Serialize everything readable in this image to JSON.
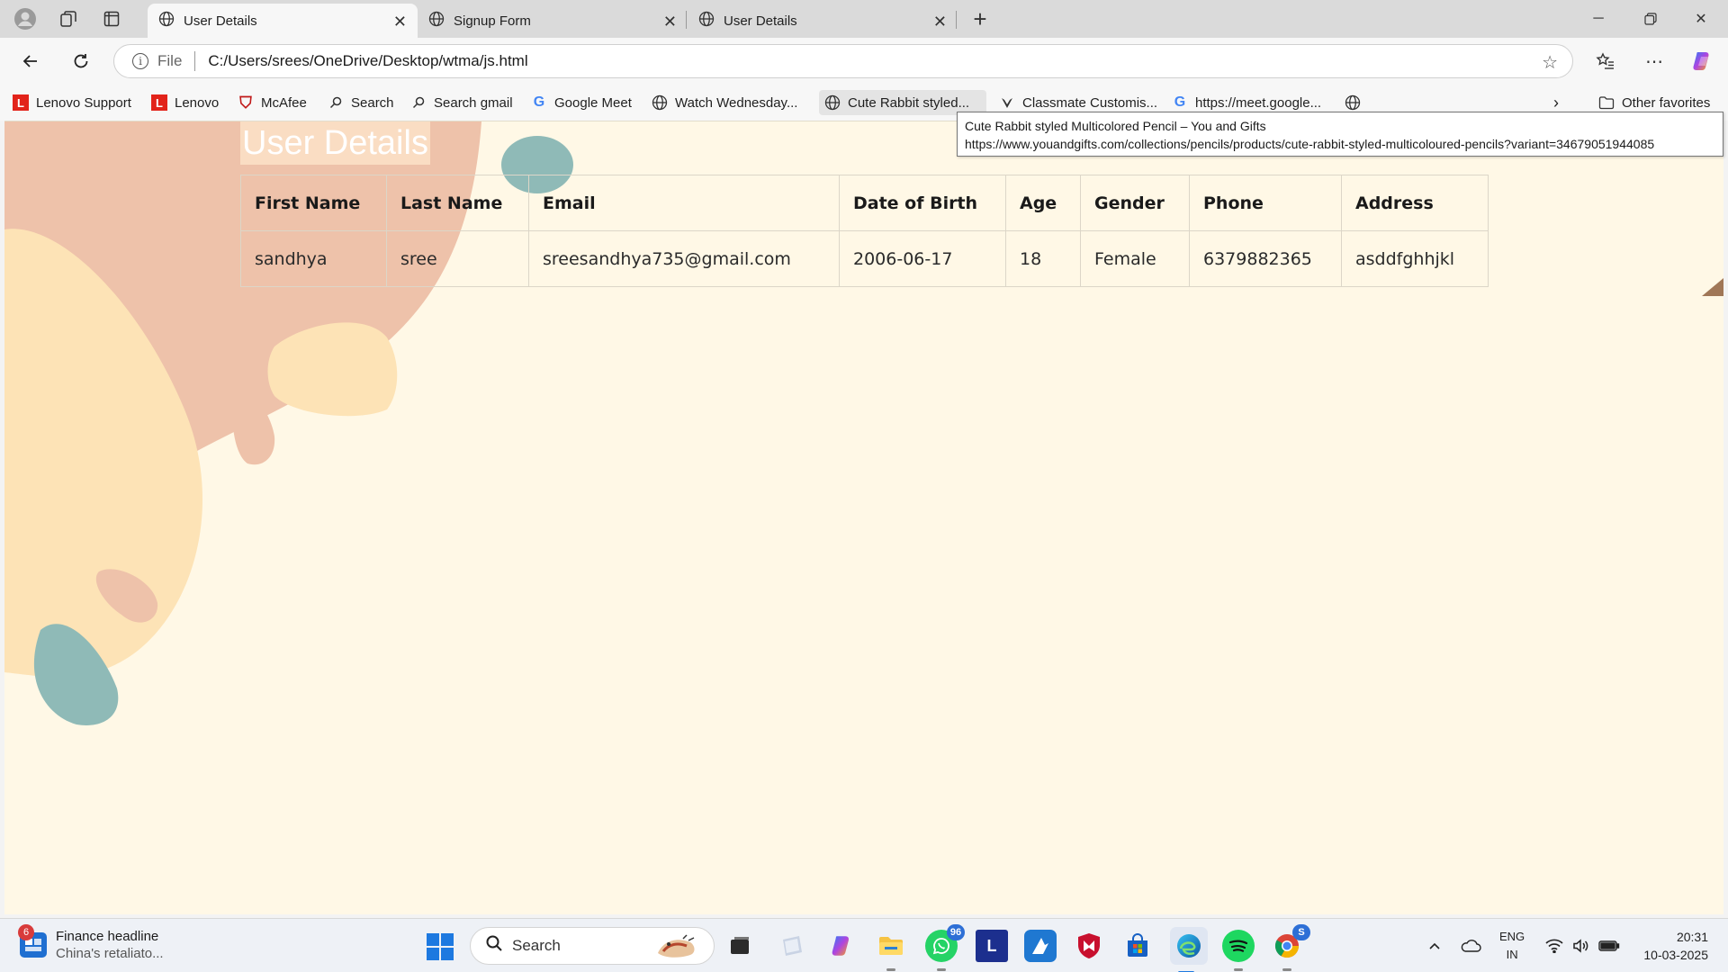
{
  "browser": {
    "tabs": [
      {
        "label": "User Details",
        "active": true
      },
      {
        "label": "Signup Form",
        "active": false
      },
      {
        "label": "User Details",
        "active": false
      }
    ],
    "address": {
      "scheme_label": "File",
      "url": "C:/Users/srees/OneDrive/Desktop/wtma/js.html"
    },
    "bookmarks": [
      {
        "label": "Lenovo Support",
        "icon": "lenovo-icon"
      },
      {
        "label": "Lenovo",
        "icon": "lenovo-icon"
      },
      {
        "label": "McAfee",
        "icon": "mcafee-icon"
      },
      {
        "label": "Search",
        "icon": "search-icon"
      },
      {
        "label": "Search gmail",
        "icon": "search-icon"
      },
      {
        "label": "Google Meet",
        "icon": "google-icon"
      },
      {
        "label": "Watch Wednesday...",
        "icon": "globe-icon"
      },
      {
        "label": "Cute Rabbit styled...",
        "icon": "globe-icon"
      },
      {
        "label": "Classmate Customis...",
        "icon": "classmate-icon"
      },
      {
        "label": "https://meet.google...",
        "icon": "google-icon"
      }
    ],
    "other_favorites": "Other favorites",
    "tooltip": {
      "title": "Cute Rabbit styled Multicolored Pencil – You and Gifts",
      "url": "https://www.youandgifts.com/collections/pencils/products/cute-rabbit-styled-multicoloured-pencils?variant=34679051944085"
    }
  },
  "page": {
    "title": "User Details",
    "table": {
      "headers": [
        "First Name",
        "Last Name",
        "Email",
        "Date of Birth",
        "Age",
        "Gender",
        "Phone",
        "Address"
      ],
      "rows": [
        [
          "sandhya",
          "sree",
          "sreesandhya735@gmail.com",
          "2006-06-17",
          "18",
          "Female",
          "6379882365",
          "asddfghhjkl"
        ]
      ]
    },
    "colors": {
      "background": "#fff8e6",
      "blob_salmon": "#eec2aa",
      "blob_peach": "#fde3b6",
      "blob_teal": "#8fbab7"
    }
  },
  "taskbar": {
    "news": {
      "badge": "6",
      "title": "Finance headline",
      "subtitle": "China's retaliato..."
    },
    "search_label": "Search",
    "apps": [
      {
        "name": "whatsapp",
        "badge": "96"
      },
      {
        "name": "chrome",
        "badge": "S"
      }
    ],
    "lang": {
      "line1": "ENG",
      "line2": "IN"
    },
    "clock": {
      "time": "20:31",
      "date": "10-03-2025"
    }
  }
}
